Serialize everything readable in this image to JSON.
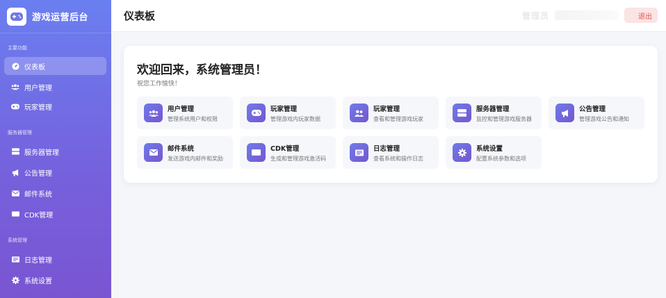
{
  "app": {
    "brand_title": "游戏运营后台"
  },
  "colors": {
    "sidebar_gradient_start": "#6a7ff0",
    "sidebar_gradient_end": "#7a55d2",
    "logout_bg": "#fbe4e4",
    "logout_text": "#e05555"
  },
  "sidebar": {
    "sections": [
      {
        "title": "主要功能"
      },
      {
        "title": "服务器管理"
      },
      {
        "title": "系统管理"
      }
    ],
    "items": [
      {
        "label": "仪表板",
        "icon": "dashboard-icon",
        "active": true
      },
      {
        "label": "用户管理",
        "icon": "users-icon",
        "active": false
      },
      {
        "label": "玩家管理",
        "icon": "gamepad-icon",
        "active": false
      },
      {
        "label": "服务器管理",
        "icon": "server-icon",
        "active": false
      },
      {
        "label": "公告管理",
        "icon": "megaphone-icon",
        "active": false
      },
      {
        "label": "邮件系统",
        "icon": "mail-icon",
        "active": false
      },
      {
        "label": "CDK管理",
        "icon": "ticket-icon",
        "active": false
      },
      {
        "label": "日志管理",
        "icon": "log-icon",
        "active": false
      },
      {
        "label": "系统设置",
        "icon": "gear-icon",
        "active": false
      }
    ]
  },
  "header": {
    "title": "仪表板",
    "user_name": "管理员",
    "logout_label": "退出"
  },
  "main": {
    "welcome_title": "欢迎回来，系统管理员！",
    "welcome_subtitle": "祝您工作愉快！",
    "tiles": [
      {
        "title": "用户管理",
        "desc": "管理系统用户和权限",
        "icon": "users-icon"
      },
      {
        "title": "玩家管理",
        "desc": "管理游戏内玩家数据",
        "icon": "gamepad-icon"
      },
      {
        "title": "玩家管理",
        "desc": "查看和管理游戏玩家",
        "icon": "players-icon"
      },
      {
        "title": "服务器管理",
        "desc": "监控和管理游戏服务器",
        "icon": "server-icon"
      },
      {
        "title": "公告管理",
        "desc": "管理游戏公告和通知",
        "icon": "megaphone-icon"
      },
      {
        "title": "邮件系统",
        "desc": "发送游戏内邮件和奖励",
        "icon": "mail-icon"
      },
      {
        "title": "CDK管理",
        "desc": "生成和管理游戏激活码",
        "icon": "ticket-icon"
      },
      {
        "title": "日志管理",
        "desc": "查看系统和操作日志",
        "icon": "log-icon"
      },
      {
        "title": "系统设置",
        "desc": "配置系统参数和选项",
        "icon": "gear-icon"
      }
    ]
  }
}
